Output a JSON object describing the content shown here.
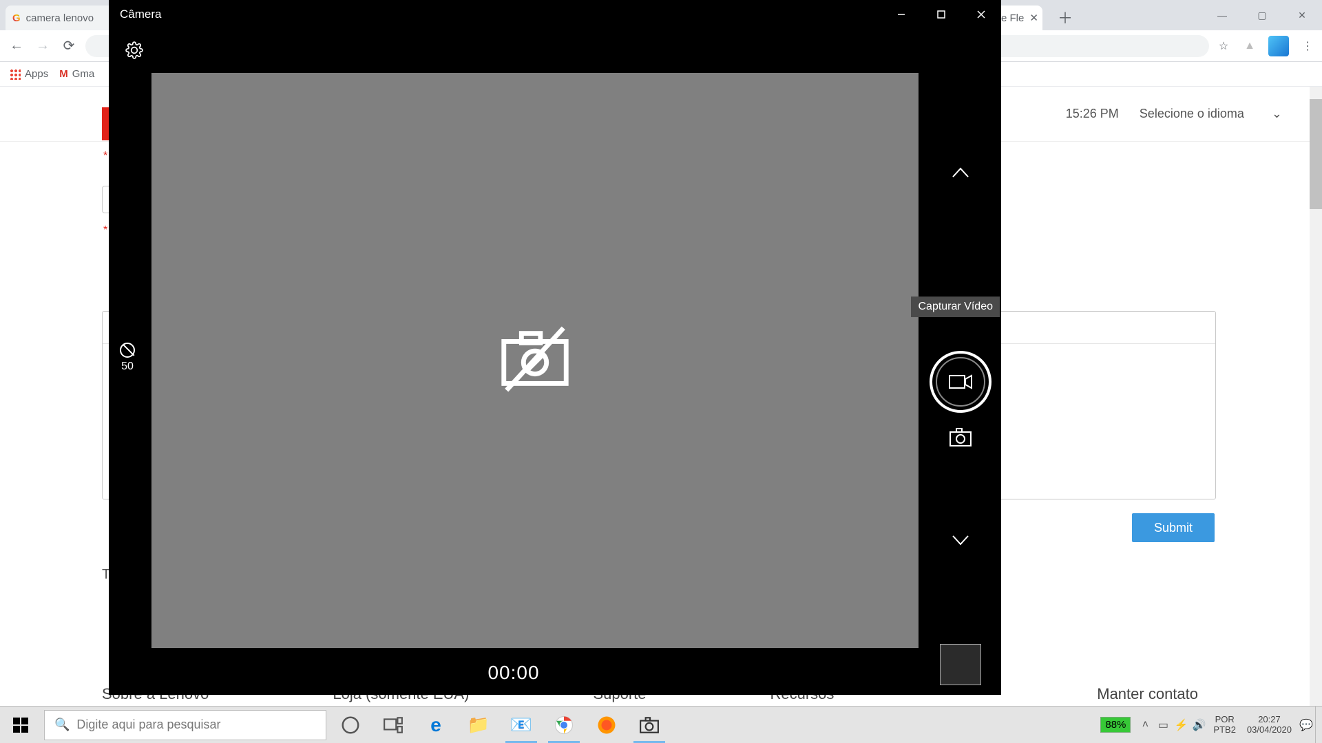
{
  "browser": {
    "tabs": [
      {
        "favicon": "G",
        "title": "camera lenovo"
      },
      {
        "favicon": "",
        "title": "e Fle",
        "closeable": true
      }
    ],
    "bookmarks": {
      "apps": "Apps",
      "gmail": "Gma"
    }
  },
  "page": {
    "time": "15:26 PM",
    "language_label": "Selecione o idioma",
    "submit": "Submit",
    "footer": {
      "about": "Sobre a Lenovo",
      "store": "Loja (somente EUA)",
      "support": "Suporte",
      "resources": "Recursos",
      "contact": "Manter contato"
    },
    "side_char": "T"
  },
  "camera": {
    "title": "Câmera",
    "zoom_value": "50",
    "timer": "00:00",
    "tooltip": "Capturar Vídeo"
  },
  "taskbar": {
    "search_placeholder": "Digite aqui para pesquisar",
    "battery": "88%",
    "lang1": "POR",
    "lang2": "PTB2",
    "clock": "20:27",
    "date": "03/04/2020"
  }
}
